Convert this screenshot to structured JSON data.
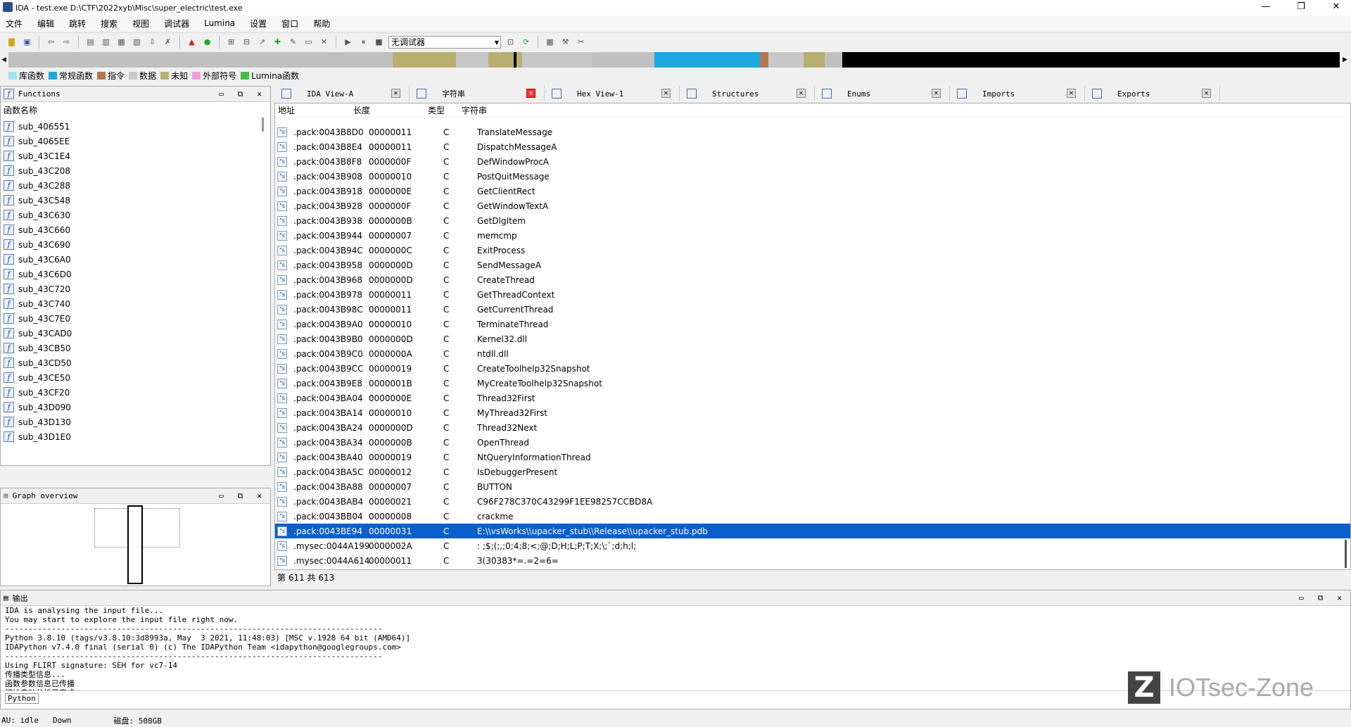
{
  "window": {
    "title": "IDA - test.exe D:\\CTF\\2022xyb\\Misc\\super_electric\\test.exe",
    "min": "—",
    "max": "❐",
    "close": "✕"
  },
  "menu": [
    "文件",
    "编辑",
    "跳转",
    "搜索",
    "视图",
    "调试器",
    "Lumina",
    "设置",
    "窗口",
    "帮助"
  ],
  "toolbar": {
    "debugger": "无调试器"
  },
  "legend": [
    {
      "label": "库函数",
      "color": "#a0e0f0"
    },
    {
      "label": "常规函数",
      "color": "#1ea8e0"
    },
    {
      "label": "指令",
      "color": "#b07850"
    },
    {
      "label": "数据",
      "color": "#c8c8c8"
    },
    {
      "label": "未知",
      "color": "#b8b070"
    },
    {
      "label": "外部符号",
      "color": "#f0a0e0"
    },
    {
      "label": "Lumina函数",
      "color": "#40c040"
    }
  ],
  "functions": {
    "title": "Functions",
    "column": "函数名称",
    "items": [
      "sub_406551",
      "sub_4065EE",
      "sub_43C1E4",
      "sub_43C208",
      "sub_43C288",
      "sub_43C548",
      "sub_43C630",
      "sub_43C660",
      "sub_43C690",
      "sub_43C6A0",
      "sub_43C6D0",
      "sub_43C720",
      "sub_43C740",
      "sub_43C7E0",
      "sub_43CAD0",
      "sub_43CB50",
      "sub_43CD50",
      "sub_43CE50",
      "sub_43CF20",
      "sub_43D090",
      "sub_43D130",
      "sub_43D1E0"
    ]
  },
  "graph": {
    "title": "Graph overview"
  },
  "tabs": [
    "IDA View-A",
    "字符串",
    "Hex View-1",
    "Structures",
    "Enums",
    "Imports",
    "Exports"
  ],
  "strings": {
    "headers": {
      "addr": "地址",
      "len": "长度",
      "type": "类型",
      "str": "字符串"
    },
    "rows": [
      {
        "addr": ".pack:0043B8D0",
        "len": "00000011",
        "type": "C",
        "str": "TranslateMessage"
      },
      {
        "addr": ".pack:0043B8E4",
        "len": "00000011",
        "type": "C",
        "str": "DispatchMessageA"
      },
      {
        "addr": ".pack:0043B8F8",
        "len": "0000000F",
        "type": "C",
        "str": "DefWindowProcA"
      },
      {
        "addr": ".pack:0043B908",
        "len": "00000010",
        "type": "C",
        "str": "PostQuitMessage"
      },
      {
        "addr": ".pack:0043B918",
        "len": "0000000E",
        "type": "C",
        "str": "GetClientRect"
      },
      {
        "addr": ".pack:0043B928",
        "len": "0000000F",
        "type": "C",
        "str": "GetWindowTextA"
      },
      {
        "addr": ".pack:0043B938",
        "len": "0000000B",
        "type": "C",
        "str": "GetDlgItem"
      },
      {
        "addr": ".pack:0043B944",
        "len": "00000007",
        "type": "C",
        "str": "memcmp"
      },
      {
        "addr": ".pack:0043B94C",
        "len": "0000000C",
        "type": "C",
        "str": "ExitProcess"
      },
      {
        "addr": ".pack:0043B958",
        "len": "0000000D",
        "type": "C",
        "str": "SendMessageA"
      },
      {
        "addr": ".pack:0043B968",
        "len": "0000000D",
        "type": "C",
        "str": "CreateThread"
      },
      {
        "addr": ".pack:0043B978",
        "len": "00000011",
        "type": "C",
        "str": "GetThreadContext"
      },
      {
        "addr": ".pack:0043B98C",
        "len": "00000011",
        "type": "C",
        "str": "GetCurrentThread"
      },
      {
        "addr": ".pack:0043B9A0",
        "len": "00000010",
        "type": "C",
        "str": "TerminateThread"
      },
      {
        "addr": ".pack:0043B9B0",
        "len": "0000000D",
        "type": "C",
        "str": "Kernel32.dll"
      },
      {
        "addr": ".pack:0043B9C0",
        "len": "0000000A",
        "type": "C",
        "str": "ntdll.dll"
      },
      {
        "addr": ".pack:0043B9CC",
        "len": "00000019",
        "type": "C",
        "str": "CreateToolhelp32Snapshot"
      },
      {
        "addr": ".pack:0043B9E8",
        "len": "0000001B",
        "type": "C",
        "str": "MyCreateToolhelp32Snapshot"
      },
      {
        "addr": ".pack:0043BA04",
        "len": "0000000E",
        "type": "C",
        "str": "Thread32First"
      },
      {
        "addr": ".pack:0043BA14",
        "len": "00000010",
        "type": "C",
        "str": "MyThread32First"
      },
      {
        "addr": ".pack:0043BA24",
        "len": "0000000D",
        "type": "C",
        "str": "Thread32Next"
      },
      {
        "addr": ".pack:0043BA34",
        "len": "0000000B",
        "type": "C",
        "str": "OpenThread"
      },
      {
        "addr": ".pack:0043BA40",
        "len": "00000019",
        "type": "C",
        "str": "NtQueryInformationThread"
      },
      {
        "addr": ".pack:0043BA5C",
        "len": "00000012",
        "type": "C",
        "str": "IsDebuggerPresent"
      },
      {
        "addr": ".pack:0043BA88",
        "len": "00000007",
        "type": "C",
        "str": "BUTTON"
      },
      {
        "addr": ".pack:0043BAB4",
        "len": "00000021",
        "type": "C",
        "str": "C96F278C370C43299F1EE98257CCBD8A"
      },
      {
        "addr": ".pack:0043BB04",
        "len": "00000008",
        "type": "C",
        "str": "crackme"
      },
      {
        "addr": ".pack:0043BE94",
        "len": "00000031",
        "type": "C",
        "str": "E:\\\\vsWorks\\\\upacker_stub\\\\Release\\\\upacker_stub.pdb"
      },
      {
        "addr": ".mysec:0044A199",
        "len": "0000002A",
        "type": "C",
        "str": ": ;$;(;,;0;4;8;<;@;D;H;L;P;T;X;\\;`;d;h;l;"
      },
      {
        "addr": ".mysec:0044A614",
        "len": "00000011",
        "type": "C",
        "str": " 3(30383*=.=2=6="
      }
    ],
    "footer": "第 611 共 613"
  },
  "output": {
    "title": "输出",
    "lines": [
      "IDA is analysing the input file...",
      "You may start to explore the input file right now.",
      "---------------------------------------------------------------------------------",
      "Python 3.8.10 (tags/v3.8.10:3d8993a, May  3 2021, 11:48:03) [MSC v.1928 64 bit (AMD64)]",
      "IDAPython v7.4.0 final (serial 0) (c) The IDAPython Team <idapython@googlegroups.com>",
      "---------------------------------------------------------------------------------",
      "Using FLIRT signature: SEH for vc7-14",
      "传播类型信息...",
      "函数参数信息已传播",
      "初始自动分析已完成。"
    ],
    "tab": "Python"
  },
  "status": {
    "au": "AU:  idle",
    "dir": "Down",
    "disk": "磁盘: 508GB"
  },
  "watermark": "IOTsec-Zone"
}
